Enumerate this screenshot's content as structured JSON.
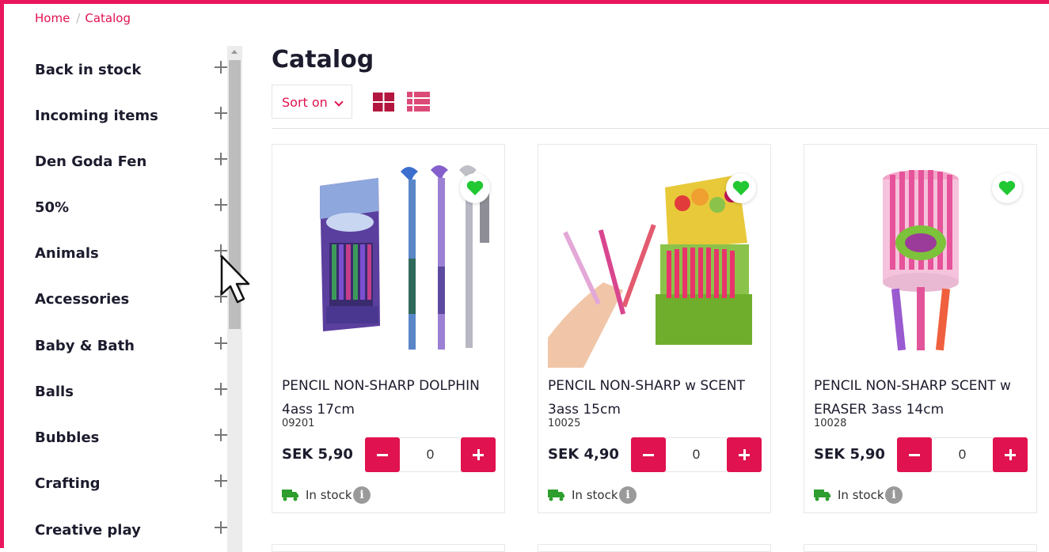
{
  "breadcrumb": {
    "home": "Home",
    "separator": "/",
    "current": "Catalog"
  },
  "sidebar": {
    "items": [
      {
        "label": "Back in stock"
      },
      {
        "label": "Incoming items"
      },
      {
        "label": "Den Goda Fen"
      },
      {
        "label": "50%"
      },
      {
        "label": "Animals"
      },
      {
        "label": "Accessories"
      },
      {
        "label": "Baby & Bath"
      },
      {
        "label": "Balls"
      },
      {
        "label": "Bubbles"
      },
      {
        "label": "Crafting"
      },
      {
        "label": "Creative play"
      }
    ]
  },
  "main": {
    "title": "Catalog",
    "sort_label": "Sort on",
    "view_modes": [
      "grid-icon",
      "list-icon"
    ]
  },
  "products": [
    {
      "name": "PENCIL NON-SHARP DOLPHIN 4ass 17cm",
      "sku": "09201",
      "price": "SEK 5,90",
      "qty": "0",
      "stock": "In stock"
    },
    {
      "name": "PENCIL NON-SHARP w SCENT 3ass 15cm",
      "sku": "10025",
      "price": "SEK 4,90",
      "qty": "0",
      "stock": "In stock"
    },
    {
      "name": "PENCIL NON-SHARP SCENT w ERASER 3ass 14cm",
      "sku": "10028",
      "price": "SEK 5,90",
      "qty": "0",
      "stock": "In stock"
    }
  ],
  "colors": {
    "accent": "#e0124f",
    "frame": "#e8175d",
    "favorite": "#22c832",
    "stock_truck": "#2e9e2e"
  }
}
